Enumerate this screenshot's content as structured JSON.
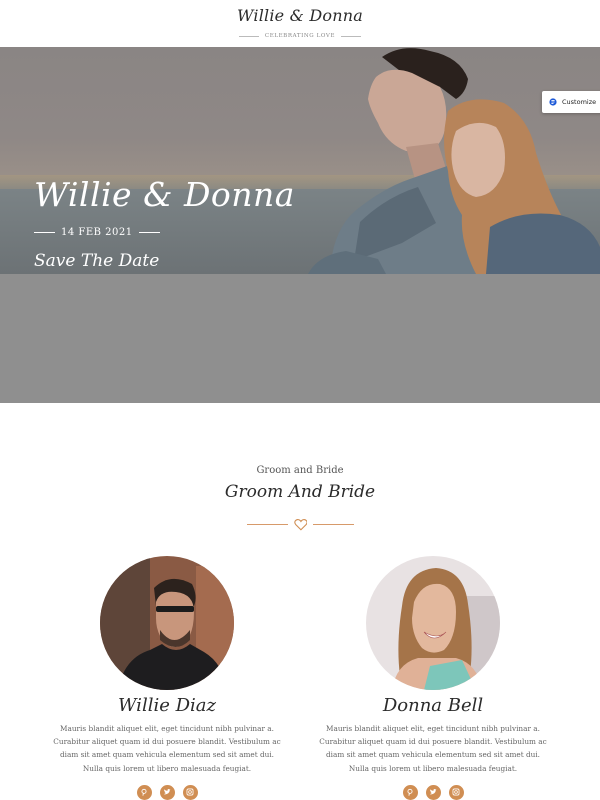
{
  "header": {
    "title": "Willie & Donna",
    "subtitle": "CELEBRATING LOVE"
  },
  "hero": {
    "title": "Willie & Donna",
    "date": "14 FEB 2021",
    "tagline": "Save The Date"
  },
  "customize": {
    "label": "Customize",
    "icon": "customize-icon"
  },
  "couple_section": {
    "kicker": "Groom and Bride",
    "title": "Groom And Bride",
    "divider_icon": "heart-icon",
    "people": [
      {
        "name": "Willie Diaz",
        "bio": "Mauris blandit aliquet elit, eget tincidunt nibh pulvinar a. Curabitur aliquet quam id dui posuere blandit. Vestibulum ac diam sit amet quam vehicula elementum sed sit amet dui. Nulla quis lorem ut libero malesuada feugiat.",
        "socials": [
          "pinterest-icon",
          "twitter-icon",
          "instagram-icon"
        ]
      },
      {
        "name": "Donna Bell",
        "bio": "Mauris blandit aliquet elit, eget tincidunt nibh pulvinar a. Curabitur aliquet quam id dui posuere blandit. Vestibulum ac diam sit amet quam vehicula elementum sed sit amet dui. Nulla quis lorem ut libero malesuada feugiat.",
        "socials": [
          "pinterest-icon",
          "twitter-icon",
          "instagram-icon"
        ]
      }
    ]
  },
  "colors": {
    "accent": "#d08e53",
    "grey_band": "#8f8f8f",
    "text_dark": "#2b2b2b"
  }
}
